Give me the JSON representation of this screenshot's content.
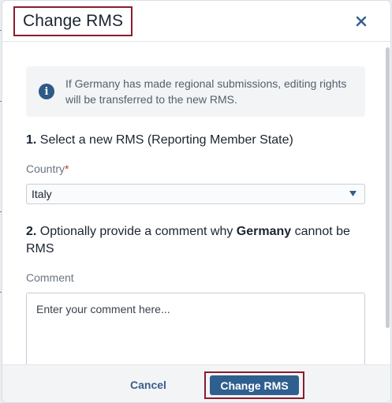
{
  "dialog": {
    "title": "Change RMS",
    "close_icon": "close-icon"
  },
  "info": {
    "icon": "info-icon",
    "icon_glyph": "i",
    "text": "If Germany has made regional submissions, editing rights will be transferred to the new RMS."
  },
  "step1": {
    "number": "1.",
    "text": " Select a new RMS (Reporting Member State)"
  },
  "country": {
    "label": "Country",
    "required_mark": "*",
    "selected": "Italy",
    "caret_icon": "caret-down-icon"
  },
  "step2": {
    "number": "2.",
    "text_before": " Optionally provide a comment why ",
    "country_bold": "Germany",
    "text_after": " cannot be RMS"
  },
  "comment": {
    "label": "Comment",
    "placeholder": "Enter your comment here..."
  },
  "footer": {
    "cancel_label": "Cancel",
    "submit_label": "Change RMS"
  },
  "colors": {
    "highlight_border": "#8b1d2c",
    "primary": "#2f5f8f",
    "link": "#3a5f8a",
    "required": "#c0392b"
  }
}
